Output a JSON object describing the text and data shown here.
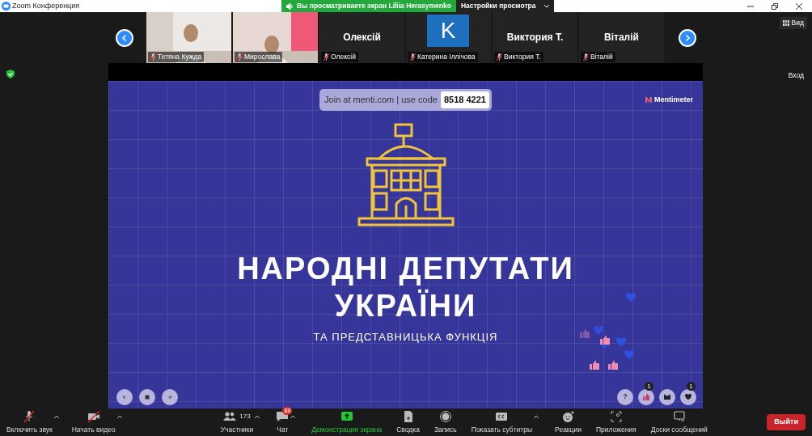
{
  "window": {
    "title": "Zoom Конференция"
  },
  "share_banner": {
    "text": "Вы просматриваете экран Liliia Herasymenko",
    "settings_button": "Настройки просмотра"
  },
  "participants": [
    {
      "kind": "video",
      "name": "Тетяна Кужда",
      "muted": true
    },
    {
      "kind": "video",
      "name": "Мирослава",
      "muted": true
    },
    {
      "kind": "name",
      "big_name": "Олексій",
      "name": "Олексій",
      "muted": true
    },
    {
      "kind": "avatar",
      "initial": "K",
      "name": "Катерина Іллічова",
      "muted": true
    },
    {
      "kind": "name",
      "big_name": "Виктория Т.",
      "name": "Виктория Т.",
      "muted": true
    },
    {
      "kind": "name",
      "big_name": "Віталій",
      "name": "Віталій",
      "muted": true
    }
  ],
  "view_button": "Вид",
  "enter_label": "Вход",
  "slide": {
    "join_text": "Join at menti.com | use code",
    "code": "8518 4221",
    "brand": "Mentimeter",
    "title_lines": [
      "НАРОДНІ ДЕПУТАТИ",
      "УКРАЇНИ"
    ],
    "subtitle": "ТА ПРЕДСТАВНИЦЬКА ФУНКЦІЯ",
    "reaction_buttons": [
      {
        "kind": "question",
        "label": "?"
      },
      {
        "kind": "thumb",
        "count": "1"
      },
      {
        "kind": "cat"
      },
      {
        "kind": "heart",
        "count": "1"
      }
    ]
  },
  "toolbar": [
    {
      "kind": "mic",
      "label": "Включить звук",
      "caret": true
    },
    {
      "kind": "video",
      "label": "Начать видео",
      "caret": true
    },
    {
      "kind": "participants",
      "label": "Участники",
      "count": "173",
      "caret": true
    },
    {
      "kind": "chat",
      "label": "Чат",
      "badge": "33",
      "caret": true
    },
    {
      "kind": "share",
      "label": "Демонстрация экрана",
      "caret": false
    },
    {
      "kind": "summary",
      "label": "Сводка",
      "caret": false
    },
    {
      "kind": "record",
      "label": "Запись",
      "caret": false
    },
    {
      "kind": "cc",
      "label": "Показать субтитры",
      "caret": true
    },
    {
      "kind": "reactions",
      "label": "Реакции",
      "caret": false
    },
    {
      "kind": "apps",
      "label": "Приложения",
      "caret": false
    },
    {
      "kind": "boards",
      "label": "Доски сообщений",
      "caret": false
    }
  ],
  "leave_button": "Выйти"
}
